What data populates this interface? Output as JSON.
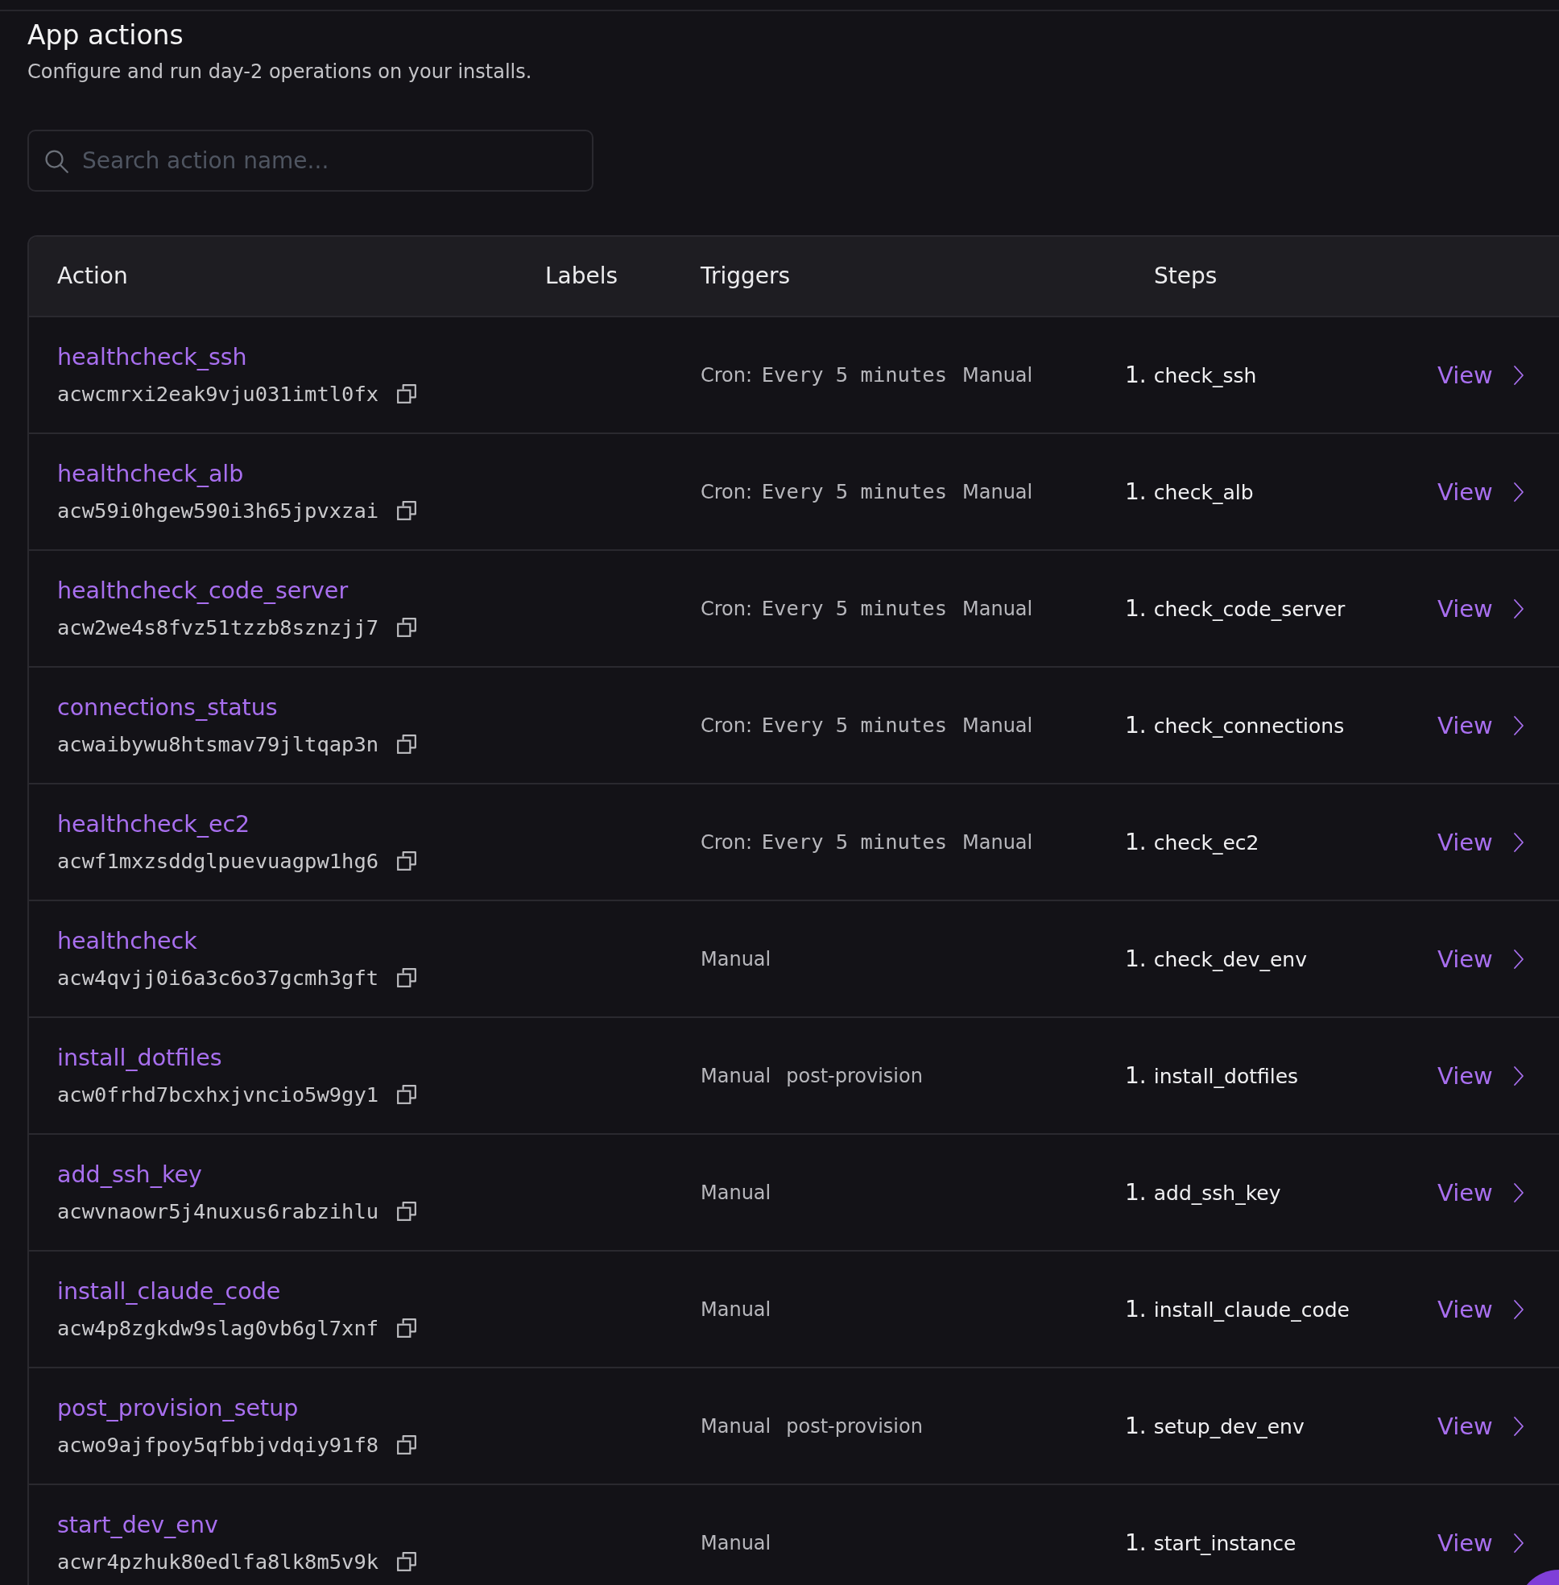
{
  "page": {
    "title": "App actions",
    "subtitle": "Configure and run day-2 operations on your installs."
  },
  "search": {
    "placeholder": "Search action name..."
  },
  "table": {
    "columns": [
      "Action",
      "Labels",
      "Triggers",
      "Steps"
    ],
    "rows": [
      {
        "name": "healthcheck_ssh",
        "id": "acwcmrxi2eak9vju031imtl0fx",
        "triggers": [
          {
            "kind": "cron",
            "label": "Cron:",
            "schedule": "Every 5 minutes"
          },
          {
            "kind": "plain",
            "label": "Manual"
          }
        ],
        "steps": [
          {
            "number": "1.",
            "name": "check_ssh"
          }
        ],
        "link": "View"
      },
      {
        "name": "healthcheck_alb",
        "id": "acw59i0hgew590i3h65jpvxzai",
        "triggers": [
          {
            "kind": "cron",
            "label": "Cron:",
            "schedule": "Every 5 minutes"
          },
          {
            "kind": "plain",
            "label": "Manual"
          }
        ],
        "steps": [
          {
            "number": "1.",
            "name": "check_alb"
          }
        ],
        "link": "View"
      },
      {
        "name": "healthcheck_code_server",
        "id": "acw2we4s8fvz51tzzb8sznzjj7",
        "triggers": [
          {
            "kind": "cron",
            "label": "Cron:",
            "schedule": "Every 5 minutes"
          },
          {
            "kind": "plain",
            "label": "Manual"
          }
        ],
        "steps": [
          {
            "number": "1.",
            "name": "check_code_server"
          }
        ],
        "link": "View"
      },
      {
        "name": "connections_status",
        "id": "acwaibywu8htsmav79jltqap3n",
        "triggers": [
          {
            "kind": "cron",
            "label": "Cron:",
            "schedule": "Every 5 minutes"
          },
          {
            "kind": "plain",
            "label": "Manual"
          }
        ],
        "steps": [
          {
            "number": "1.",
            "name": "check_connections"
          }
        ],
        "link": "View"
      },
      {
        "name": "healthcheck_ec2",
        "id": "acwf1mxzsddglpuevuagpw1hg6",
        "triggers": [
          {
            "kind": "cron",
            "label": "Cron:",
            "schedule": "Every 5 minutes"
          },
          {
            "kind": "plain",
            "label": "Manual"
          }
        ],
        "steps": [
          {
            "number": "1.",
            "name": "check_ec2"
          }
        ],
        "link": "View"
      },
      {
        "name": "healthcheck",
        "id": "acw4qvjj0i6a3c6o37gcmh3gft",
        "triggers": [
          {
            "kind": "plain",
            "label": "Manual"
          }
        ],
        "steps": [
          {
            "number": "1.",
            "name": "check_dev_env"
          }
        ],
        "link": "View"
      },
      {
        "name": "install_dotfiles",
        "id": "acw0frhd7bcxhxjvncio5w9gy1",
        "triggers": [
          {
            "kind": "plain",
            "label": "Manual"
          },
          {
            "kind": "plain",
            "label": "post-provision"
          }
        ],
        "steps": [
          {
            "number": "1.",
            "name": "install_dotfiles"
          }
        ],
        "link": "View"
      },
      {
        "name": "add_ssh_key",
        "id": "acwvnaowr5j4nuxus6rabzihlu",
        "triggers": [
          {
            "kind": "plain",
            "label": "Manual"
          }
        ],
        "steps": [
          {
            "number": "1.",
            "name": "add_ssh_key"
          }
        ],
        "link": "View"
      },
      {
        "name": "install_claude_code",
        "id": "acw4p8zgkdw9slag0vb6gl7xnf",
        "triggers": [
          {
            "kind": "plain",
            "label": "Manual"
          }
        ],
        "steps": [
          {
            "number": "1.",
            "name": "install_claude_code"
          }
        ],
        "link": "View"
      },
      {
        "name": "post_provision_setup",
        "id": "acwo9ajfpoy5qfbbjvdqiy91f8",
        "triggers": [
          {
            "kind": "plain",
            "label": "Manual"
          },
          {
            "kind": "plain",
            "label": "post-provision"
          }
        ],
        "steps": [
          {
            "number": "1.",
            "name": "setup_dev_env"
          }
        ],
        "link": "View"
      },
      {
        "name": "start_dev_env",
        "id": "acwr4pzhuk80edlfa8lk8m5v9k",
        "triggers": [
          {
            "kind": "plain",
            "label": "Manual"
          }
        ],
        "steps": [
          {
            "number": "1.",
            "name": "start_instance"
          }
        ],
        "link": "View"
      }
    ]
  }
}
